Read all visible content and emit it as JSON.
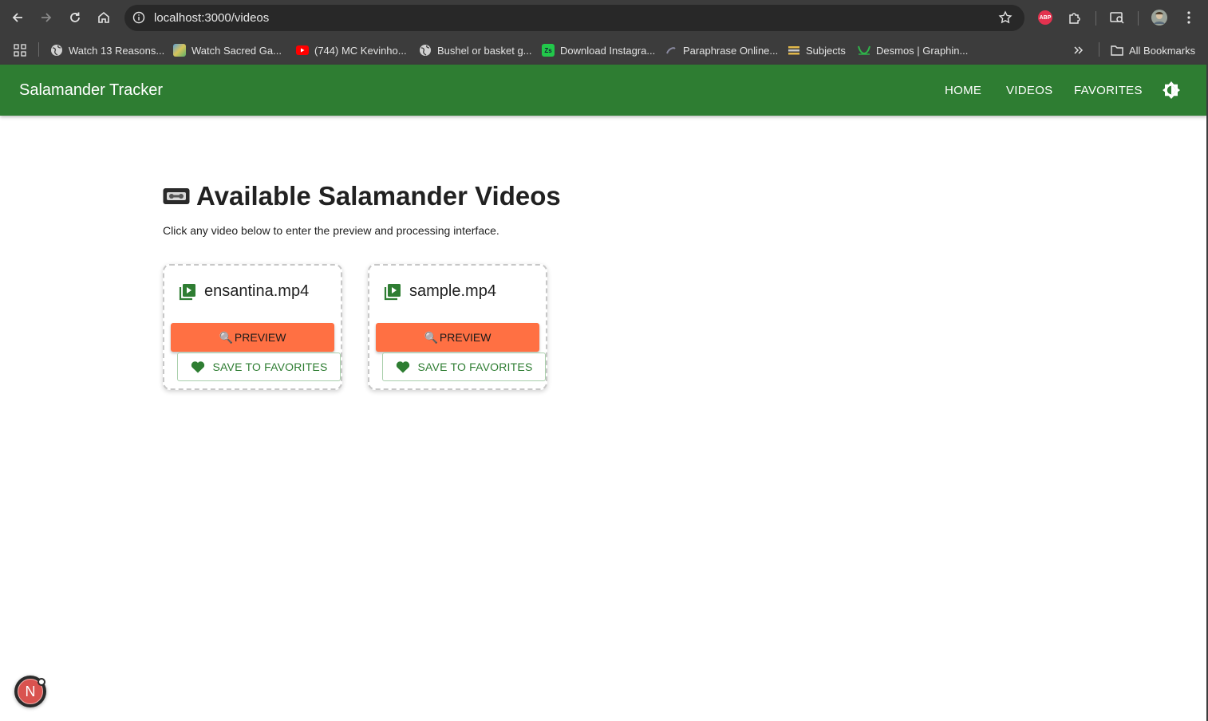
{
  "browser": {
    "url": "localhost:3000/videos",
    "bookmarks": [
      {
        "label": "Watch 13 Reasons...",
        "icon": "globe-icon"
      },
      {
        "label": "Watch Sacred Ga...",
        "icon": "map-favicon"
      },
      {
        "label": "(744) MC Kevinho...",
        "icon": "youtube-icon"
      },
      {
        "label": "Bushel or basket g...",
        "icon": "globe-icon"
      },
      {
        "label": "Download Instagra...",
        "icon": "zs-favicon",
        "icon_text": "Zs"
      },
      {
        "label": "Paraphrase Online...",
        "icon": "paraphrase-favicon"
      },
      {
        "label": "Subjects",
        "icon": "subjects-favicon"
      },
      {
        "label": "Desmos | Graphin...",
        "icon": "desmos-favicon"
      }
    ],
    "all_bookmarks_label": "All Bookmarks",
    "abp_label": "ABP"
  },
  "app": {
    "title": "Salamander Tracker",
    "nav": [
      "HOME",
      "VIDEOS",
      "FAVORITES"
    ],
    "brand_color": "#2e7d32",
    "accent_color": "#ff7043"
  },
  "page": {
    "heading": "Available Salamander Videos",
    "subtitle": "Click any video below to enter the preview and processing interface."
  },
  "videos": [
    {
      "name": "ensantina.mp4",
      "preview_label": "PREVIEW",
      "favorite_label": "SAVE TO FAVORITES"
    },
    {
      "name": "sample.mp4",
      "preview_label": "PREVIEW",
      "favorite_label": "SAVE TO FAVORITES"
    }
  ],
  "dev_badge": {
    "letter": "N"
  }
}
